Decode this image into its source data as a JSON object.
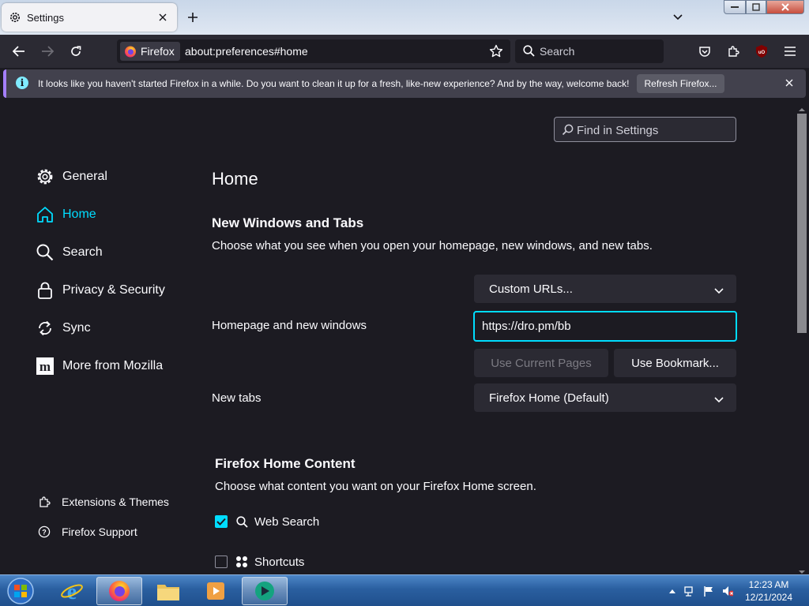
{
  "tab": {
    "title": "Settings"
  },
  "urlbar": {
    "identity": "Firefox",
    "url": "about:preferences#home"
  },
  "searchbar": {
    "placeholder": "Search"
  },
  "notification": {
    "message": "It looks like you haven't started Firefox in a while. Do you want to clean it up for a fresh, like-new experience? And by the way, welcome back!",
    "button_label": "Refresh Firefox..."
  },
  "find": {
    "placeholder": "Find in Settings"
  },
  "sidebar": {
    "items": [
      {
        "label": "General",
        "icon": "gear-icon"
      },
      {
        "label": "Home",
        "icon": "home-icon"
      },
      {
        "label": "Search",
        "icon": "search-icon"
      },
      {
        "label": "Privacy & Security",
        "icon": "lock-icon"
      },
      {
        "label": "Sync",
        "icon": "sync-icon"
      },
      {
        "label": "More from Mozilla",
        "icon": "mozilla-icon"
      }
    ],
    "footer": [
      {
        "label": "Extensions & Themes",
        "icon": "puzzle-icon"
      },
      {
        "label": "Firefox Support",
        "icon": "help-icon"
      }
    ]
  },
  "main": {
    "title": "Home",
    "new_windows": {
      "heading": "New Windows and Tabs",
      "description": "Choose what you see when you open your homepage, new windows, and new tabs.",
      "homepage_mode": "Custom URLs...",
      "homepage_label": "Homepage and new windows",
      "homepage_value": "https://dro.pm/bb",
      "use_current_label": "Use Current Pages",
      "use_bookmark_label": "Use Bookmark...",
      "newtabs_label": "New tabs",
      "newtabs_value": "Firefox Home (Default)"
    },
    "home_content": {
      "heading": "Firefox Home Content",
      "description": "Choose what content you want on your Firefox Home screen.",
      "web_search": {
        "label": "Web Search",
        "checked": true
      },
      "shortcuts": {
        "label": "Shortcuts",
        "checked": false
      }
    }
  },
  "taskbar": {
    "clock_time": "12:23 AM",
    "clock_date": "12/21/2024"
  },
  "colors": {
    "accent": "#00ddff",
    "background": "#1c1b22",
    "surface": "#2b2a33"
  }
}
